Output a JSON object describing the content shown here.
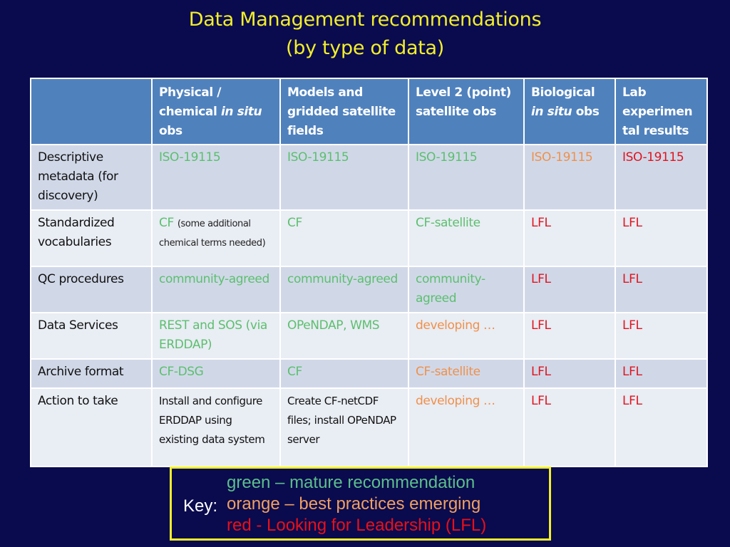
{
  "title": {
    "line1": "Data Management recommendations",
    "line2": "(by type of data)"
  },
  "colors": {
    "green": "#5cbf6e",
    "orange": "#f0904a",
    "red": "#e0141e",
    "header_bg": "#4f81bd",
    "title": "#f2ef2a",
    "background": "#0a0a4e"
  },
  "table": {
    "columns": [
      {
        "pre": "",
        "italic": "",
        "post": ""
      },
      {
        "pre": "Physical / chemical ",
        "italic": "in situ",
        "post": " obs"
      },
      {
        "pre": "Models and gridded satellite fields",
        "italic": "",
        "post": ""
      },
      {
        "pre": "Level 2 (point) satellite obs",
        "italic": "",
        "post": ""
      },
      {
        "pre": "Biological ",
        "italic": "in situ",
        "post": " obs"
      },
      {
        "pre": "Lab experimen tal results",
        "italic": "",
        "post": ""
      }
    ],
    "rows": [
      {
        "label": "Descriptive metadata (for discovery)",
        "cells": [
          {
            "text": "ISO-19115",
            "status": "green"
          },
          {
            "text": "ISO-19115",
            "status": "green"
          },
          {
            "text": "ISO-19115",
            "status": "green"
          },
          {
            "text": "ISO-19115",
            "status": "orange"
          },
          {
            "text": "ISO-19115",
            "status": "red"
          }
        ]
      },
      {
        "label": "Standardized vocabularies",
        "cells": [
          {
            "text": "CF",
            "note": "(some additional chemical terms needed)",
            "status": "green"
          },
          {
            "text": "CF",
            "status": "green"
          },
          {
            "text": "CF-satellite",
            "status": "green"
          },
          {
            "text": "LFL",
            "status": "red"
          },
          {
            "text": "LFL",
            "status": "red"
          }
        ]
      },
      {
        "label": "QC procedures",
        "cells": [
          {
            "text": "community-agreed",
            "status": "green"
          },
          {
            "text": "community-agreed",
            "status": "green"
          },
          {
            "text": "community-agreed",
            "status": "green"
          },
          {
            "text": "LFL",
            "status": "red"
          },
          {
            "text": "LFL",
            "status": "red"
          }
        ]
      },
      {
        "label": "Data Services",
        "cells": [
          {
            "text": "REST and SOS (via ERDDAP)",
            "status": "green"
          },
          {
            "text": "OPeNDAP, WMS",
            "status": "green"
          },
          {
            "text": "developing …",
            "status": "orange"
          },
          {
            "text": "LFL",
            "status": "red"
          },
          {
            "text": "LFL",
            "status": "red"
          }
        ]
      },
      {
        "label": "Archive format",
        "cells": [
          {
            "text": "CF-DSG",
            "status": "green"
          },
          {
            "text": "CF",
            "status": "green"
          },
          {
            "text": "CF-satellite",
            "status": "orange"
          },
          {
            "text": "LFL",
            "status": "red"
          },
          {
            "text": "LFL",
            "status": "red"
          }
        ]
      },
      {
        "label": "Action to take",
        "cells": [
          {
            "text": "Install and configure ERDDAP using existing data system",
            "status": "black"
          },
          {
            "text": "Create CF-netCDF files; install OPeNDAP server",
            "status": "black"
          },
          {
            "text": "developing …",
            "status": "orange"
          },
          {
            "text": "LFL",
            "status": "red"
          },
          {
            "text": "LFL",
            "status": "red"
          }
        ]
      }
    ]
  },
  "key": {
    "label": "Key:",
    "green": "green – mature recommendation",
    "orange": "orange – best practices emerging",
    "red": "red - Looking for Leadership (LFL)"
  }
}
